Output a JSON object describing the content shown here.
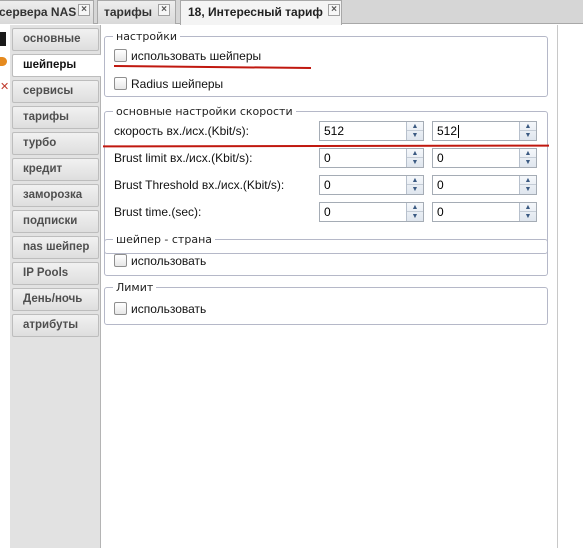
{
  "tabs": [
    {
      "label": "сервера NAS",
      "closable": true
    },
    {
      "label": "тарифы",
      "closable": true
    },
    {
      "label": "18, Интересный тариф",
      "closable": true
    }
  ],
  "close_glyph": "×",
  "sidebar": {
    "items": [
      {
        "label": "основные"
      },
      {
        "label": "шейперы",
        "active": true
      },
      {
        "label": "сервисы"
      },
      {
        "label": "тарифы"
      },
      {
        "label": "турбо"
      },
      {
        "label": "кредит"
      },
      {
        "label": "заморозка"
      },
      {
        "label": "подписки"
      },
      {
        "label": "nas шейпер"
      },
      {
        "label": "IP Pools"
      },
      {
        "label": "День/ночь"
      },
      {
        "label": "атрибуты"
      }
    ]
  },
  "settings": {
    "legend": "настройки",
    "use_shapers": {
      "label": "использовать шейперы",
      "checked": false
    },
    "radius_shapers": {
      "label": "Radius шейперы",
      "checked": false
    }
  },
  "speed": {
    "legend": "основные настройки скорости",
    "rows": [
      {
        "label": "скорость вх./исх.(Kbit/s):",
        "in": "512",
        "out": "512"
      },
      {
        "label": "Brust limit вх./исх.(Kbit/s):",
        "in": "0",
        "out": "0"
      },
      {
        "label": "Brust Threshold вх./исх.(Kbit/s):",
        "in": "0",
        "out": "0"
      },
      {
        "label": "Brust time.(sec):",
        "in": "0",
        "out": "0"
      }
    ]
  },
  "country_shaper": {
    "legend": "шейпер - страна",
    "use": {
      "label": "использовать",
      "checked": false
    }
  },
  "limit": {
    "legend": "Лимит",
    "use": {
      "label": "использовать",
      "checked": false
    }
  },
  "spin_glyphs": {
    "up": "▲",
    "down": "▼"
  },
  "colors": {
    "annotation_red": "#c0180f",
    "nav_text": "#4f4f4f",
    "border": "#b5b8c8"
  }
}
